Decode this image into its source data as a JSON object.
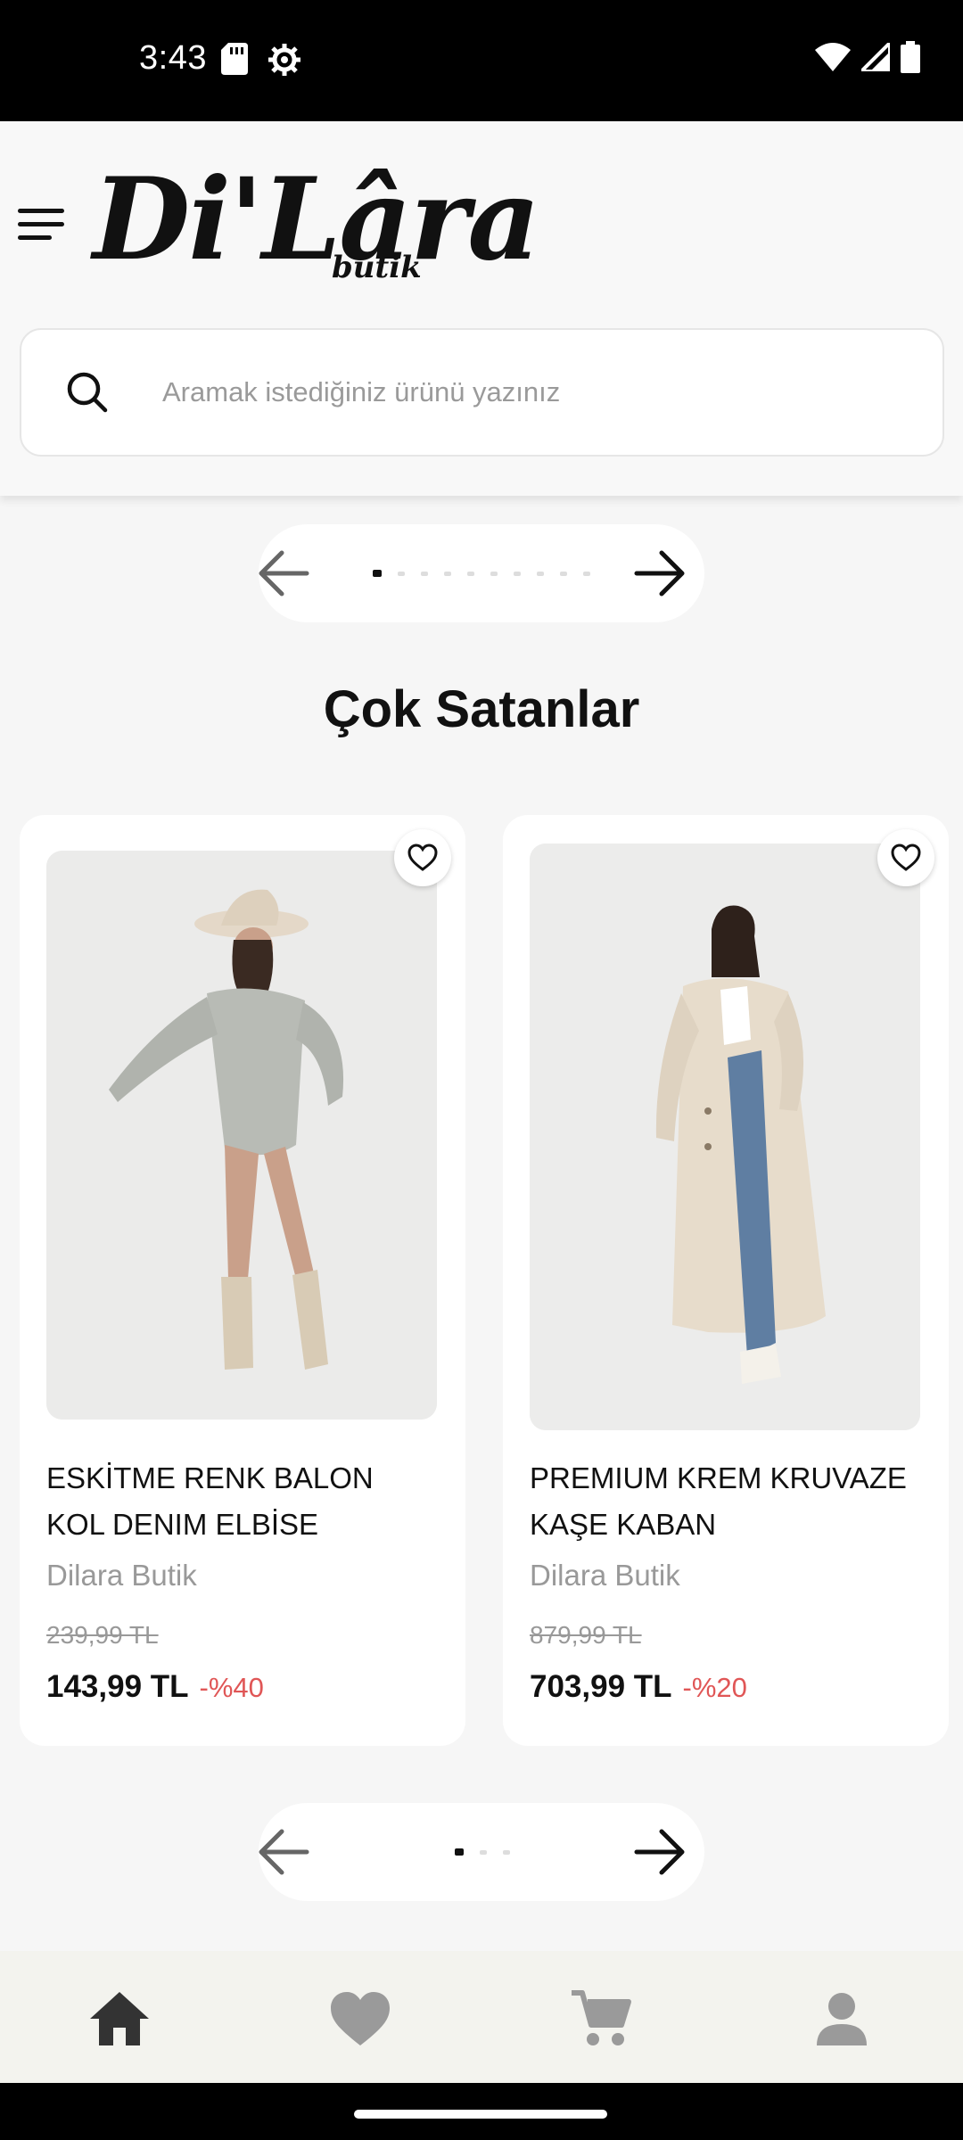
{
  "status_bar": {
    "time": "3:43",
    "left_icons": [
      "sd-card-icon",
      "settings-gear-icon"
    ],
    "right_icons": [
      "wifi-icon",
      "signal-icon",
      "battery-icon"
    ]
  },
  "header": {
    "menu_icon": "hamburger-menu-icon",
    "logo_text": "Di'Lâra",
    "logo_subtext": "butik"
  },
  "search": {
    "icon": "search-icon",
    "placeholder": "Aramak istediğiniz ürünü yazınız",
    "value": ""
  },
  "banner_pager": {
    "prev_icon": "arrow-left-icon",
    "next_icon": "arrow-right-icon",
    "dot_count": 10,
    "active_index": 0
  },
  "section": {
    "title": "Çok Satanlar"
  },
  "products": [
    {
      "name": "ESKİTME RENK BALON KOL DENIM ELBİSE",
      "brand": "Dilara Butik",
      "old_price": "239,99 TL",
      "price": "143,99 TL",
      "discount": "-%40",
      "favorite_icon": "heart-outline-icon"
    },
    {
      "name": "PREMIUM KREM KRUVAZE KAŞE KABAN",
      "brand": "Dilara Butik",
      "old_price": "879,99 TL",
      "price": "703,99 TL",
      "discount": "-%20",
      "favorite_icon": "heart-outline-icon"
    }
  ],
  "products_pager": {
    "prev_icon": "arrow-left-icon",
    "next_icon": "arrow-right-icon",
    "dot_count": 3,
    "active_index": 0
  },
  "bottom_nav": {
    "items": [
      {
        "icon": "home-icon",
        "active": true
      },
      {
        "icon": "heart-icon",
        "active": false
      },
      {
        "icon": "cart-icon",
        "active": false
      },
      {
        "icon": "profile-icon",
        "active": false
      }
    ]
  },
  "colors": {
    "discount": "#e05656",
    "nav_active": "#333333",
    "nav_inactive": "#9a9a9a"
  }
}
